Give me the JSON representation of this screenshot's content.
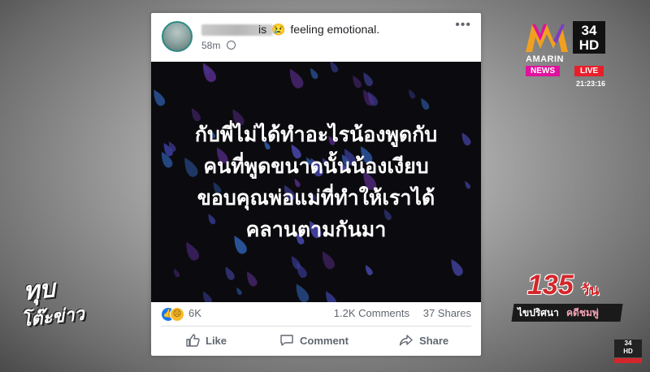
{
  "post": {
    "status_word": "is",
    "status_emoji": "😢",
    "status_text": "feeling emotional.",
    "time": "58m",
    "menu_icon": "more-dots-icon",
    "quote_lines": [
      "กับพี่ไม่ได้ทำอะไรน้องพูดกับ",
      "คนที่พูดขนาดนั้นน้องเงียบ",
      "ขอบคุณพ่อแม่ที่ทำให้เราได้",
      "คลานตามกันมา"
    ],
    "reaction_count": "6K",
    "comments": "1.2K Comments",
    "shares": "37 Shares",
    "actions": {
      "like": "Like",
      "comment": "Comment",
      "share": "Share"
    }
  },
  "channel": {
    "name": "AMARIN",
    "number": "34",
    "hd": "HD",
    "news": "NEWS",
    "live": "LIVE",
    "time": "21:23:16"
  },
  "show": {
    "logo_line1": "ทุบ",
    "logo_line2": "โต๊ะข่าว"
  },
  "badge": {
    "number": "135",
    "unit": "วัน",
    "name1": "ไขปริศนา",
    "name2": "คดีชมพู่"
  },
  "colors": {
    "facebook_blue": "#1877f2",
    "live_red": "#e81f2b",
    "news_pink": "#e0119d",
    "badge_red": "#d4262a"
  }
}
